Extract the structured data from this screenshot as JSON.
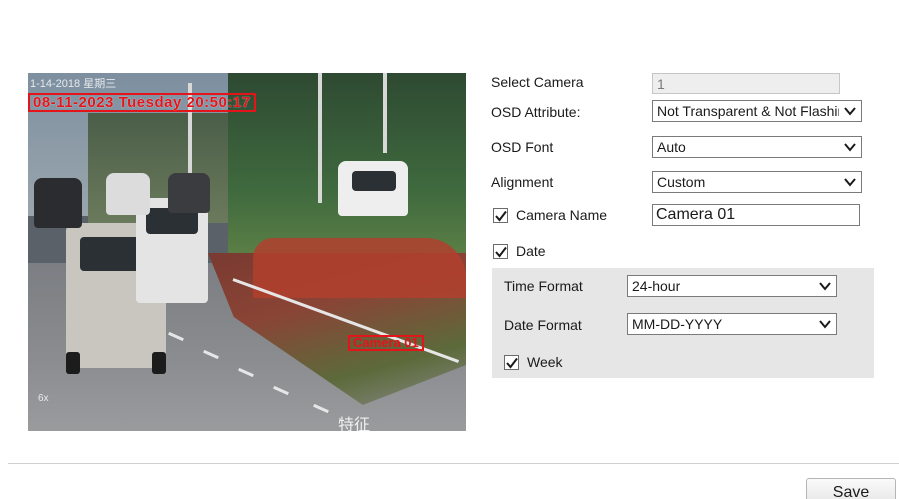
{
  "preview": {
    "osd_time": "08-11-2023 Tuesday 20:50:17",
    "osd_top_faint": "1-14-2018 星期三",
    "osd_camera": "Camera 01",
    "osd_zoom": "6x",
    "osd_corner": "特征"
  },
  "form": {
    "select_camera": {
      "label": "Select Camera",
      "value": "1"
    },
    "osd_attribute": {
      "label": "OSD Attribute:",
      "value": "Not Transparent & Not Flashing"
    },
    "osd_font": {
      "label": "OSD Font",
      "value": "Auto"
    },
    "alignment": {
      "label": "Alignment",
      "value": "Custom"
    },
    "camera_name": {
      "label": "Camera Name",
      "value": "Camera 01",
      "checked": true
    },
    "date": {
      "label": "Date",
      "checked": true
    },
    "time_format": {
      "label": "Time Format",
      "value": "24-hour"
    },
    "date_format": {
      "label": "Date Format",
      "value": "MM-DD-YYYY"
    },
    "week": {
      "label": "Week",
      "checked": true
    }
  },
  "footer": {
    "save_label": "Save"
  },
  "colors": {
    "osd_red": "#e3141a",
    "panel_gray": "#e6e6e6",
    "border": "#7a7a7a"
  }
}
